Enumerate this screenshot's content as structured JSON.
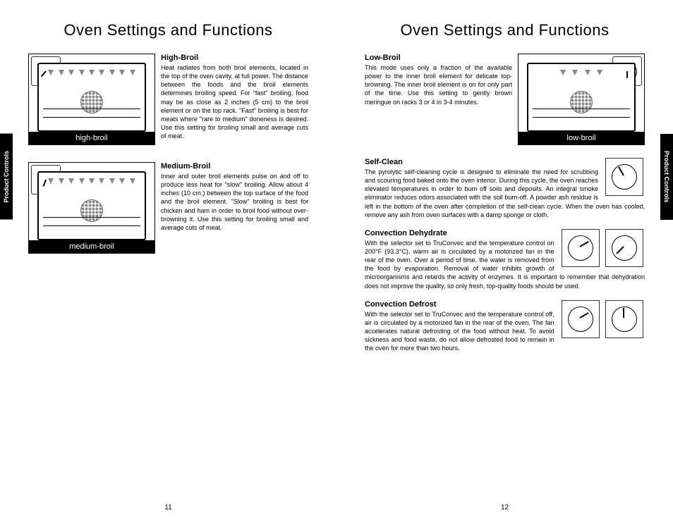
{
  "pageTitle": "Oven Settings and Functions",
  "sideTab": "Product Controls",
  "pageNumbers": {
    "left": "11",
    "right": "12"
  },
  "left": {
    "highBroil": {
      "title": "High-Broil",
      "label": "high-broil",
      "body": "Heat radiates from both broil elements, located in the top of the oven cavity, at full power. The distance between the foods and the broil elements determines broiling speed. For \"fast\" broiling, food may be as close as 2 inches (5 cm) to the broil element or on the top rack. \"Fast\" broiling is best for meats where \"rare to medium\" doneness is desired. Use this setting for broiling small and average cuts of meat."
    },
    "mediumBroil": {
      "title": "Medium-Broil",
      "label": "medium-broil",
      "body": "Inner and outer broil elements pulse on and off to produce less heat for \"slow\" broiling. Allow about 4 inches (10 cm.) between the top surface of the food and the broil element. \"Slow\" broiling is best for chicken and ham in order to broil food without over-browning it. Use this setting for broiling small and average cuts of meat."
    }
  },
  "right": {
    "lowBroil": {
      "title": "Low-Broil",
      "label": "low-broil",
      "body": "This mode uses only a fraction of the available power to the inner broil element for delicate top-browning. The inner broil element is on for only part of the time. Use this setting to gently brown meringue on racks 3 or 4 in 3-4 minutes."
    },
    "selfClean": {
      "title": "Self-Clean",
      "body": "The pyrolytic self-cleaning cycle is designed to eliminate the need for scrubbing and scouring food baked onto the oven interior. During this cycle, the oven reaches elevated temperatures in order to burn off soils and deposits. An integral smoke eliminator reduces odors associated with the soil burn-off. A powder ash residue is left in the bottom of the oven after completion of the self-clean cycle. When the oven has cooled, remove any ash from oven surfaces with a damp sponge or cloth."
    },
    "convDehydrate": {
      "title": "Convection Dehydrate",
      "body": "With the selector set to TruConvec and the temperature control on 200°F (93.3°C), warm air is circulated by a motorized fan in the rear of the oven. Over a period of time, the water is removed from the food by evaporation. Removal of water inhibits growth of microorganisms and retards the activity of enzymes. It is important to remember that dehydration does not improve the quality, so only fresh, top-quality foods should be used."
    },
    "convDefrost": {
      "title": "Convection Defrost",
      "body": "With the selector set to TruConvec and the temperature control off, air is circulated by a motorized fan in the rear of the oven. The fan accelerates natural defrosting of the food without heat. To avoid sickness and food waste, do not allow defrosted food to remain in the oven for more than two hours."
    }
  }
}
